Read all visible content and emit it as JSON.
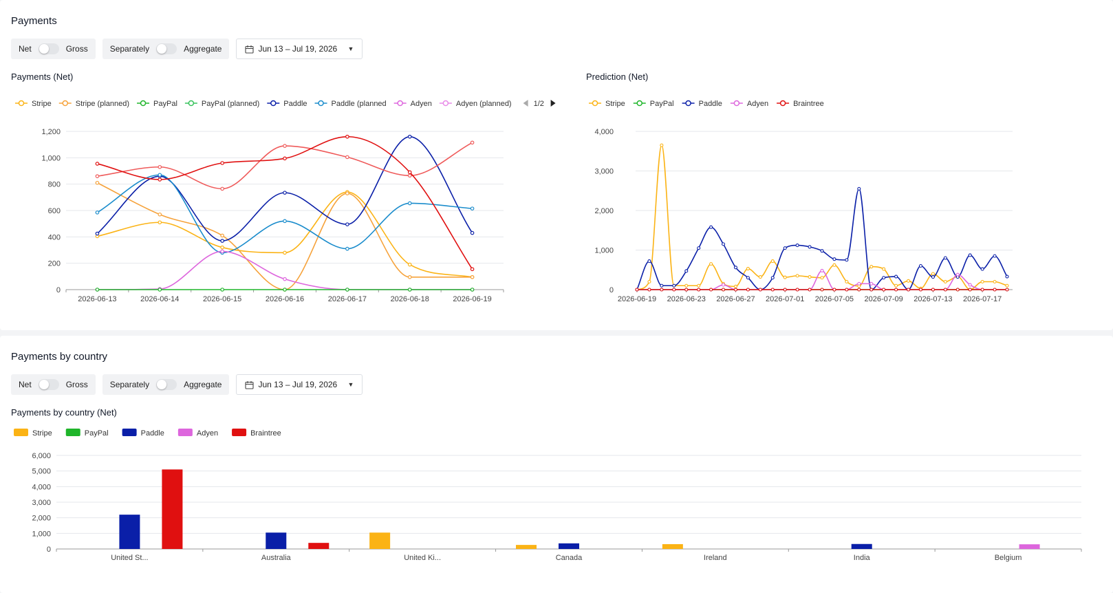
{
  "payments": {
    "title": "Payments",
    "toggle1": {
      "left": "Net",
      "right": "Gross"
    },
    "toggle2": {
      "left": "Separately",
      "right": "Aggregate"
    },
    "date_range": "Jun 13 – Jul 19, 2026",
    "chart_title": "Payments (Net)",
    "legend_page": "1/2",
    "prediction_title": "Prediction (Net)"
  },
  "country": {
    "title": "Payments by country",
    "toggle1": {
      "left": "Net",
      "right": "Gross"
    },
    "toggle2": {
      "left": "Separately",
      "right": "Aggregate"
    },
    "date_range": "Jun 13 – Jul 19, 2026",
    "chart_title": "Payments by country (Net)"
  },
  "colors": {
    "Stripe": "#fbb315",
    "PayPal": "#1fb52a",
    "Paddle": "#0a1fa8",
    "Adyen": "#dd66dd",
    "Braintree": "#e01010",
    "StripeLight": "#f6a23a",
    "PaddleLight": "#1a8ccc",
    "BraintreeLight": "#ef5a5a"
  },
  "chart_data": [
    {
      "type": "line",
      "title": "Payments (Net)",
      "x": [
        "2026-06-13",
        "2026-06-14",
        "2026-06-15",
        "2026-06-16",
        "2026-06-17",
        "2026-06-18",
        "2026-06-19"
      ],
      "ylim": [
        0,
        1200
      ],
      "yticks": [
        "0",
        "200",
        "400",
        "600",
        "800",
        "1,000",
        "1,200"
      ],
      "legend": [
        "Stripe",
        "Stripe (planned)",
        "PayPal",
        "PayPal (planned)",
        "Paddle",
        "Paddle (planned",
        "Adyen",
        "Adyen (planned)"
      ],
      "series": [
        {
          "name": "Stripe",
          "color": "#fbb315",
          "values": [
            405,
            510,
            320,
            280,
            740,
            190,
            95
          ]
        },
        {
          "name": "Stripe (planned)",
          "color": "#f6a23a",
          "values": [
            810,
            570,
            410,
            0,
            730,
            95,
            95
          ]
        },
        {
          "name": "Paddle",
          "color": "#0a1fa8",
          "values": [
            425,
            860,
            370,
            735,
            495,
            1160,
            430
          ]
        },
        {
          "name": "Paddle (planned",
          "color": "#1a8ccc",
          "values": [
            585,
            870,
            280,
            520,
            310,
            655,
            615
          ]
        },
        {
          "name": "Adyen",
          "color": "#dd66dd",
          "values": [
            0,
            5,
            290,
            80,
            0,
            0,
            0
          ]
        },
        {
          "name": "PayPal",
          "color": "#1fb52a",
          "values": [
            0,
            0,
            0,
            0,
            0,
            0,
            0
          ]
        },
        {
          "name": "",
          "color": "#ef5a5a",
          "values": [
            860,
            930,
            765,
            1090,
            1005,
            865,
            1115
          ]
        },
        {
          "name": "",
          "color": "#e01010",
          "values": [
            955,
            835,
            960,
            995,
            1160,
            890,
            155
          ]
        }
      ]
    },
    {
      "type": "line",
      "title": "Prediction (Net)",
      "x": [
        "2026-06-19",
        "2026-06-20",
        "2026-06-21",
        "2026-06-22",
        "2026-06-23",
        "2026-06-24",
        "2026-06-25",
        "2026-06-26",
        "2026-06-27",
        "2026-06-28",
        "2026-06-29",
        "2026-06-30",
        "2026-07-01",
        "2026-07-02",
        "2026-07-03",
        "2026-07-04",
        "2026-07-05",
        "2026-07-06",
        "2026-07-07",
        "2026-07-08",
        "2026-07-09",
        "2026-07-10",
        "2026-07-11",
        "2026-07-12",
        "2026-07-13",
        "2026-07-14",
        "2026-07-15",
        "2026-07-16",
        "2026-07-17",
        "2026-07-18",
        "2026-07-19"
      ],
      "xticks": [
        "2026-06-19",
        "2026-06-23",
        "2026-06-27",
        "2026-07-01",
        "2026-07-05",
        "2026-07-09",
        "2026-07-13",
        "2026-07-17"
      ],
      "ylim": [
        0,
        4000
      ],
      "yticks": [
        "0",
        "1,000",
        "2,000",
        "3,000",
        "4,000"
      ],
      "legend": [
        "Stripe",
        "PayPal",
        "Paddle",
        "Adyen",
        "Braintree"
      ],
      "series": [
        {
          "name": "Stripe",
          "color": "#fbb315",
          "values": [
            0,
            200,
            3650,
            100,
            100,
            100,
            650,
            150,
            80,
            530,
            320,
            720,
            310,
            350,
            320,
            300,
            620,
            200,
            90,
            580,
            520,
            100,
            220,
            30,
            400,
            200,
            330,
            0,
            200,
            200,
            100
          ]
        },
        {
          "name": "PayPal",
          "color": "#1fb52a",
          "values": [
            0,
            0,
            0,
            0,
            0,
            0,
            0,
            0,
            0,
            0,
            0,
            0,
            0,
            0,
            0,
            0,
            0,
            0,
            0,
            0,
            0,
            0,
            0,
            0,
            0,
            0,
            0,
            0,
            0,
            0,
            0
          ]
        },
        {
          "name": "Paddle",
          "color": "#0a1fa8",
          "values": [
            0,
            720,
            100,
            100,
            470,
            1050,
            1580,
            1150,
            560,
            300,
            0,
            300,
            1050,
            1120,
            1080,
            980,
            770,
            750,
            2550,
            0,
            300,
            330,
            0,
            600,
            320,
            800,
            320,
            870,
            520,
            850,
            330
          ]
        },
        {
          "name": "Adyen",
          "color": "#dd66dd",
          "values": [
            0,
            0,
            0,
            0,
            0,
            0,
            0,
            120,
            0,
            0,
            0,
            0,
            0,
            0,
            0,
            480,
            0,
            0,
            150,
            150,
            0,
            0,
            0,
            0,
            0,
            0,
            380,
            120,
            0,
            0,
            0
          ]
        },
        {
          "name": "Braintree",
          "color": "#e01010",
          "values": [
            0,
            0,
            0,
            0,
            0,
            0,
            0,
            0,
            0,
            0,
            0,
            0,
            0,
            0,
            0,
            0,
            0,
            0,
            0,
            0,
            0,
            0,
            0,
            0,
            0,
            0,
            0,
            0,
            0,
            0,
            0
          ]
        }
      ]
    },
    {
      "type": "bar",
      "title": "Payments by country (Net)",
      "categories": [
        "United St...",
        "Australia",
        "United Ki...",
        "Canada",
        "Ireland",
        "India",
        "Belgium"
      ],
      "ylim": [
        0,
        6000
      ],
      "yticks": [
        "0",
        "1,000",
        "2,000",
        "3,000",
        "4,000",
        "5,000",
        "6,000"
      ],
      "legend": [
        "Stripe",
        "PayPal",
        "Paddle",
        "Adyen",
        "Braintree"
      ],
      "series": [
        {
          "name": "Stripe",
          "color": "#fbb315",
          "values": [
            0,
            0,
            1050,
            260,
            310,
            0,
            0
          ]
        },
        {
          "name": "PayPal",
          "color": "#1fb52a",
          "values": [
            0,
            0,
            0,
            0,
            0,
            0,
            0
          ]
        },
        {
          "name": "Paddle",
          "color": "#0a1fa8",
          "values": [
            2200,
            1050,
            0,
            360,
            0,
            320,
            0
          ]
        },
        {
          "name": "Adyen",
          "color": "#dd66dd",
          "values": [
            0,
            0,
            0,
            0,
            0,
            0,
            300
          ]
        },
        {
          "name": "Braintree",
          "color": "#e01010",
          "values": [
            5100,
            390,
            0,
            0,
            0,
            0,
            0
          ]
        }
      ]
    }
  ]
}
